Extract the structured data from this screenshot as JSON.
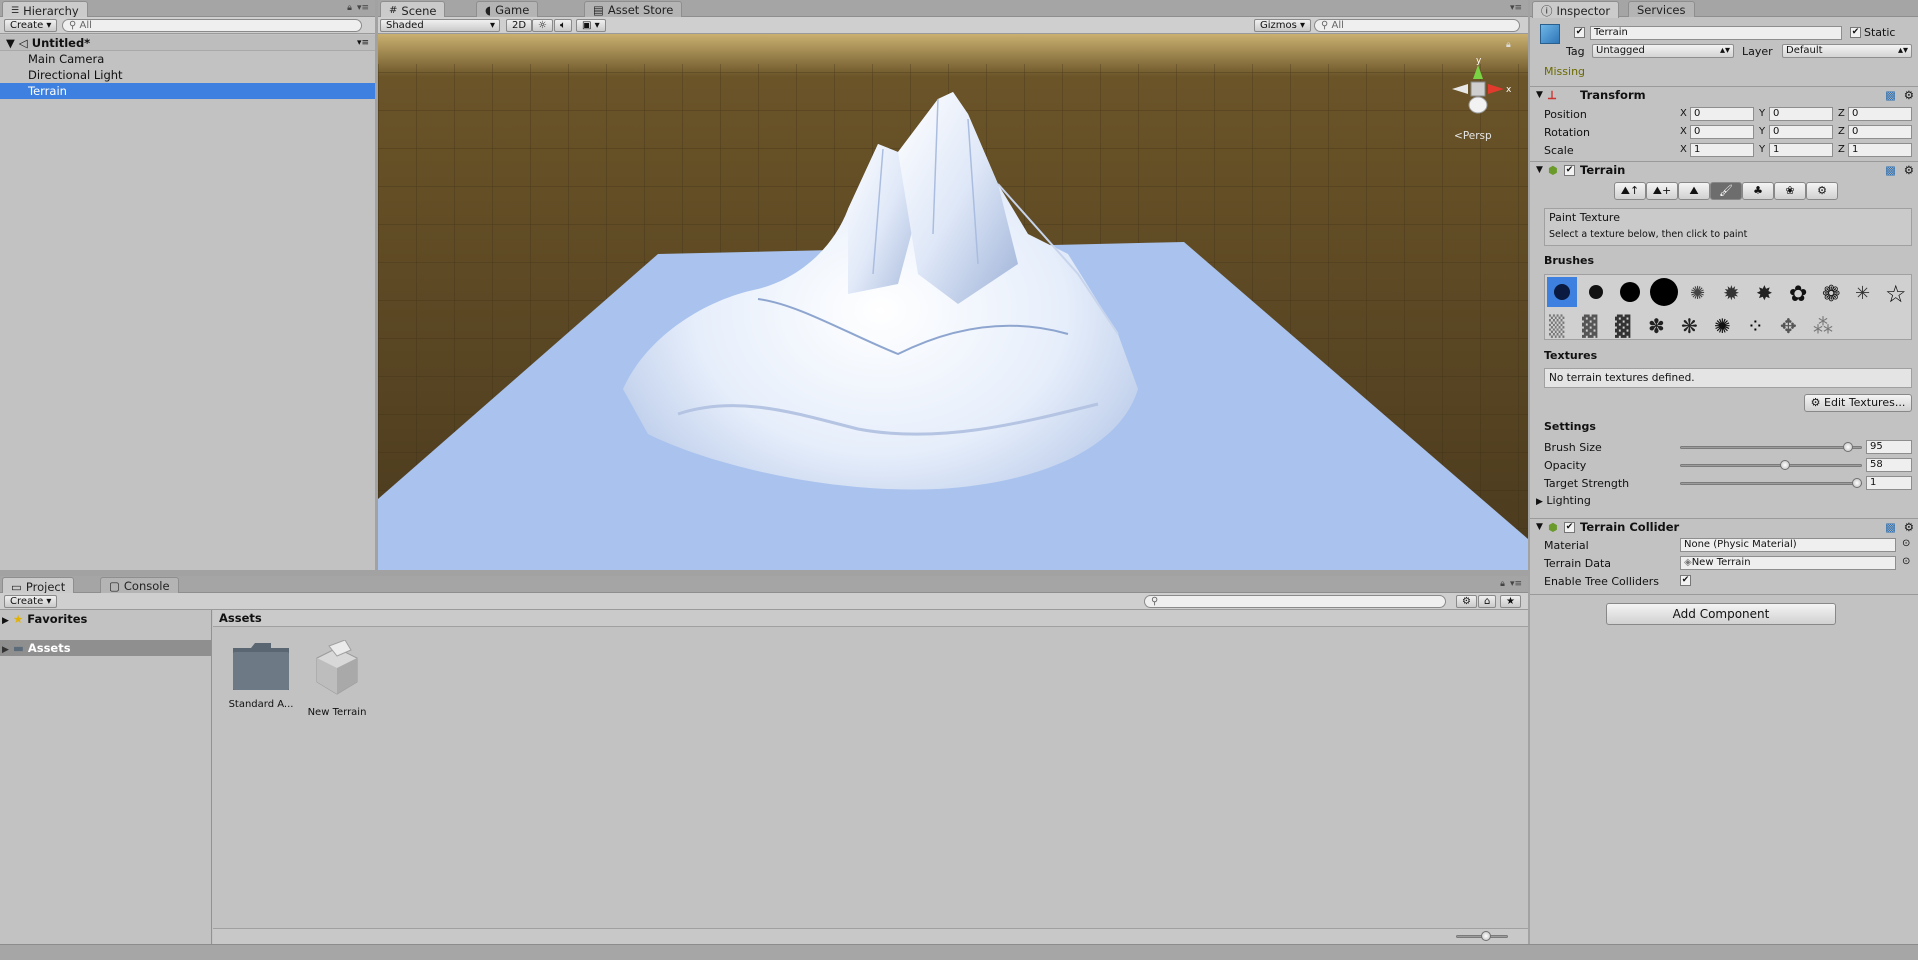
{
  "hierarchy": {
    "tab": "Hierarchy",
    "create": "Create",
    "search_placeholder": "All",
    "scene_name": "Untitled*",
    "items": [
      "Main Camera",
      "Directional Light",
      "Terrain"
    ]
  },
  "scene": {
    "tabs": [
      "Scene",
      "Game",
      "Asset Store"
    ],
    "shading": "Shaded",
    "mode_2d": "2D",
    "gizmos": "Gizmos",
    "search_placeholder": "All",
    "persp": "Persp",
    "axis_y": "y",
    "axis_x": "x"
  },
  "project": {
    "tabs": [
      "Project",
      "Console"
    ],
    "create": "Create",
    "favorites": "Favorites",
    "assets_folder": "Assets",
    "assets_header": "Assets",
    "items": [
      {
        "label": "Standard A...",
        "icon": "folder-icon"
      },
      {
        "label": "New Terrain",
        "icon": "terrain-asset-icon"
      }
    ]
  },
  "inspector": {
    "tabs": [
      "Inspector",
      "Services"
    ],
    "object_name": "Terrain",
    "static_label": "Static",
    "tag_label": "Tag",
    "tag_value": "Untagged",
    "layer_label": "Layer",
    "layer_value": "Default",
    "missing": "Missing",
    "transform": {
      "title": "Transform",
      "position_label": "Position",
      "position": [
        "0",
        "0",
        "0"
      ],
      "rotation_label": "Rotation",
      "rotation": [
        "0",
        "0",
        "0"
      ],
      "scale_label": "Scale",
      "scale": [
        "1",
        "1",
        "1"
      ],
      "x": "X",
      "y": "Y",
      "z": "Z"
    },
    "terrain": {
      "title": "Terrain",
      "tool_title": "Paint Texture",
      "tool_desc": "Select a texture below, then click to paint",
      "brushes_label": "Brushes",
      "textures_label": "Textures",
      "no_textures": "No terrain textures defined.",
      "edit_textures": "Edit Textures...",
      "settings_label": "Settings",
      "brush_size_label": "Brush Size",
      "brush_size": "95",
      "brush_size_frac": 0.95,
      "opacity_label": "Opacity",
      "opacity": "58",
      "opacity_frac": 0.58,
      "target_strength_label": "Target Strength",
      "target_strength": "1",
      "target_strength_frac": 1.0,
      "lighting_label": "Lighting"
    },
    "collider": {
      "title": "Terrain Collider",
      "material_label": "Material",
      "material_value": "None (Physic Material)",
      "terrain_data_label": "Terrain Data",
      "terrain_data_value": "New Terrain",
      "tree_colliders_label": "Enable Tree Colliders"
    },
    "add_component": "Add Component"
  },
  "colors": {
    "selection": "#3d80df",
    "scene_ground": "#4a3a1f",
    "terrain_plane": "#a9c3ee"
  }
}
